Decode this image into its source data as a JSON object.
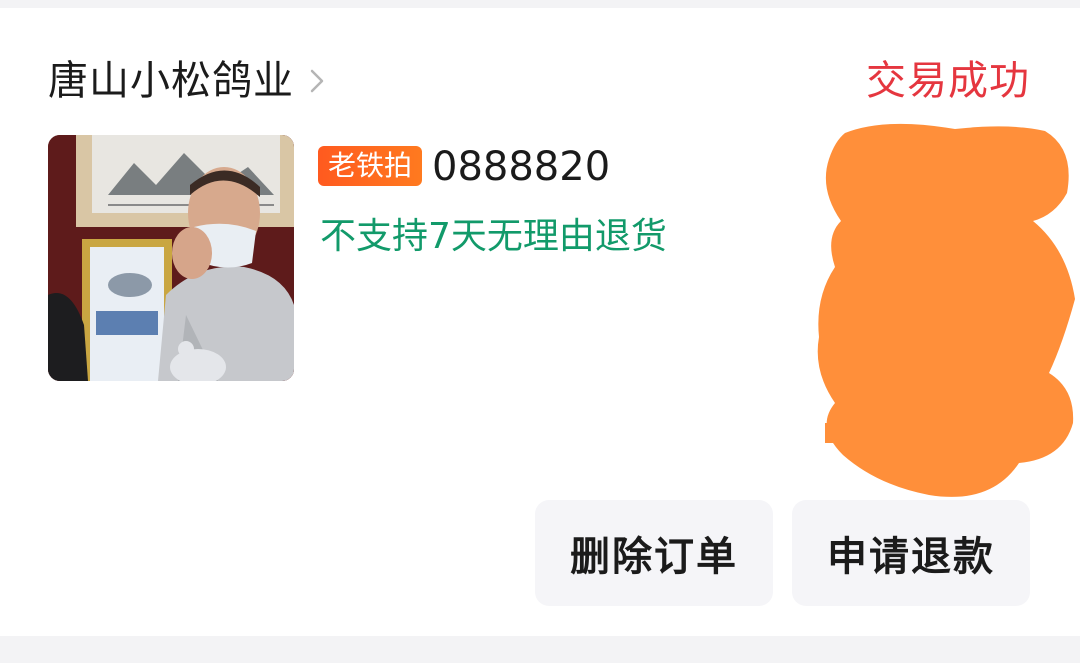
{
  "order": {
    "shop_name": "唐山小松鸽业",
    "status": "交易成功",
    "status_color": "#e5363f",
    "item": {
      "tag": "老铁拍",
      "title": "0888820",
      "policy": "不支持7天无理由退货",
      "policy_color": "#129a6a"
    },
    "actions": {
      "delete_label": "删除订单",
      "refund_label": "申请退款"
    }
  },
  "icons": {
    "shop_chevron": "chevron-right-icon"
  },
  "redaction": {
    "color": "#ff8f3a"
  }
}
